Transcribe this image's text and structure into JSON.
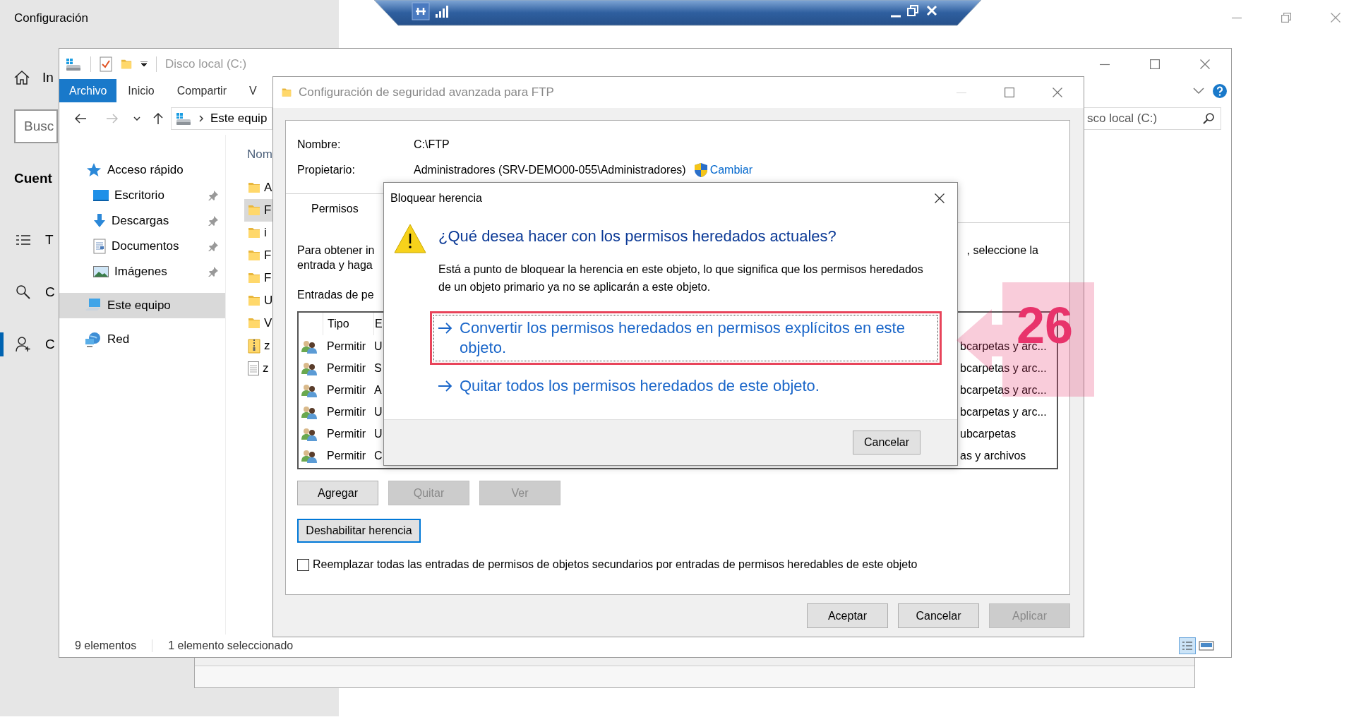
{
  "settings": {
    "title": "Configuración",
    "home_label": "In",
    "search": {
      "placeholder": "Busc"
    },
    "section_heading": "Cuent",
    "nav": [
      {
        "kind": "list",
        "label": "T",
        "selected": false
      },
      {
        "kind": "search",
        "label": "C",
        "selected": false
      },
      {
        "kind": "person",
        "label": "C",
        "selected": true
      }
    ]
  },
  "explorer": {
    "title": "Disco local (C:)",
    "ribbon_tabs": [
      {
        "label": "Archivo",
        "selected": true
      },
      {
        "label": "Inicio",
        "selected": false
      },
      {
        "label": "Compartir",
        "selected": false
      },
      {
        "label": "V",
        "selected": false
      }
    ],
    "address": "Este equip",
    "search": {
      "placeholder": "sco local (C:)"
    },
    "nav": [
      {
        "kind": "quick",
        "label": "Acceso rápido",
        "pinned": false,
        "selected": false
      },
      {
        "kind": "desktop",
        "label": "Escritorio",
        "pinned": true,
        "selected": false
      },
      {
        "kind": "downloads",
        "label": "Descargas",
        "pinned": true,
        "selected": false
      },
      {
        "kind": "documents",
        "label": "Documentos",
        "pinned": true,
        "selected": false
      },
      {
        "kind": "pictures",
        "label": "Imágenes",
        "pinned": true,
        "selected": false
      },
      {
        "kind": "pc",
        "label": "Este equipo",
        "pinned": false,
        "selected": true
      },
      {
        "kind": "network",
        "label": "Red",
        "pinned": false,
        "selected": false
      }
    ],
    "column_header": "Nom",
    "files": [
      {
        "kind": "folder",
        "name": "A",
        "selected": false
      },
      {
        "kind": "folder",
        "name": "F",
        "selected": true
      },
      {
        "kind": "folder",
        "name": "i",
        "selected": false
      },
      {
        "kind": "folder",
        "name": "F",
        "selected": false
      },
      {
        "kind": "folder",
        "name": "F",
        "selected": false
      },
      {
        "kind": "folder",
        "name": "U",
        "selected": false
      },
      {
        "kind": "folder",
        "name": "V",
        "selected": false
      },
      {
        "kind": "zip",
        "name": "z",
        "selected": false
      },
      {
        "kind": "file",
        "name": "z",
        "selected": false
      }
    ],
    "status": [
      "9 elementos",
      "1 elemento seleccionado"
    ]
  },
  "security_dialog": {
    "title": "Configuración de seguridad avanzada para FTP",
    "name_label": "Nombre:",
    "name_value": "C:\\FTP",
    "owner_label": "Propietario:",
    "owner_value": "Administradores (SRV-DEMO00-055\\Administradores)",
    "change_link": "Cambiar",
    "tabs": [
      {
        "label": "Permisos",
        "selected": true
      }
    ],
    "intro": [
      "Para obtener in",
      ", seleccione la",
      "entrada y haga"
    ],
    "entries_label": "Entradas de pe",
    "columns": [
      "Tipo",
      "E"
    ],
    "rows": [
      {
        "type": "Permitir",
        "column_2": "U",
        "applies_to": "bcarpetas y arc..."
      },
      {
        "type": "Permitir",
        "column_2": "S",
        "applies_to": "bcarpetas y arc..."
      },
      {
        "type": "Permitir",
        "column_2": "A",
        "applies_to": "bcarpetas y arc..."
      },
      {
        "type": "Permitir",
        "column_2": "U",
        "applies_to": "bcarpetas y arc..."
      },
      {
        "type": "Permitir",
        "column_2": "U",
        "applies_to": "ubcarpetas"
      },
      {
        "type": "Permitir",
        "column_2": "C",
        "applies_to": "as y archivos"
      }
    ],
    "list_buttons": [
      {
        "label": "Agregar",
        "disabled": false
      },
      {
        "label": "Quitar",
        "disabled": true
      },
      {
        "label": "Ver",
        "disabled": true
      }
    ],
    "disable_inheritance": "Deshabilitar herencia",
    "replace_option": {
      "label": "Reemplazar todas las entradas de permisos de objetos secundarios por entradas de permisos heredables de este objeto",
      "checked": false
    },
    "footer_buttons": [
      {
        "label": "Aceptar",
        "disabled": false
      },
      {
        "label": "Cancelar",
        "disabled": false
      },
      {
        "label": "Aplicar",
        "disabled": true
      }
    ]
  },
  "block_dialog": {
    "title": "Bloquear herencia",
    "heading": "¿Qué desea hacer con los permisos heredados actuales?",
    "body": "Está a punto de bloquear la herencia en este objeto, lo que significa que los permisos heredados de un objeto primario ya no se aplicarán a este objeto.",
    "options": [
      {
        "label": "Convertir los permisos heredados en permisos explícitos en este objeto.",
        "selected": true,
        "highlighted": true
      },
      {
        "label": "Quitar todos los permisos heredados de este objeto.",
        "selected": false,
        "highlighted": false
      }
    ],
    "cancel": "Cancelar"
  },
  "callout": {
    "number": "26"
  }
}
